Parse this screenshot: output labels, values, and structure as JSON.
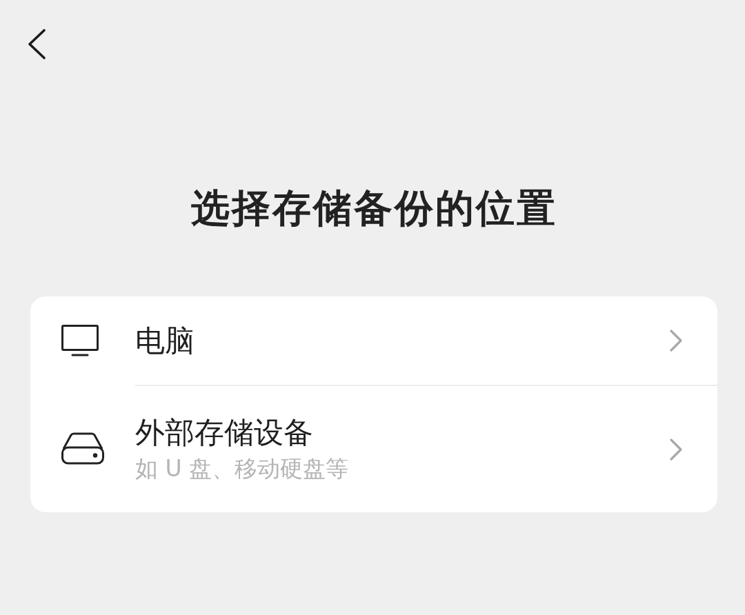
{
  "title": "选择存储备份的位置",
  "locations": [
    {
      "kind": "computer",
      "title": "电脑"
    },
    {
      "kind": "storage",
      "title": "外部存储设备",
      "subtitle": "如 U 盘、移动硬盘等"
    }
  ]
}
